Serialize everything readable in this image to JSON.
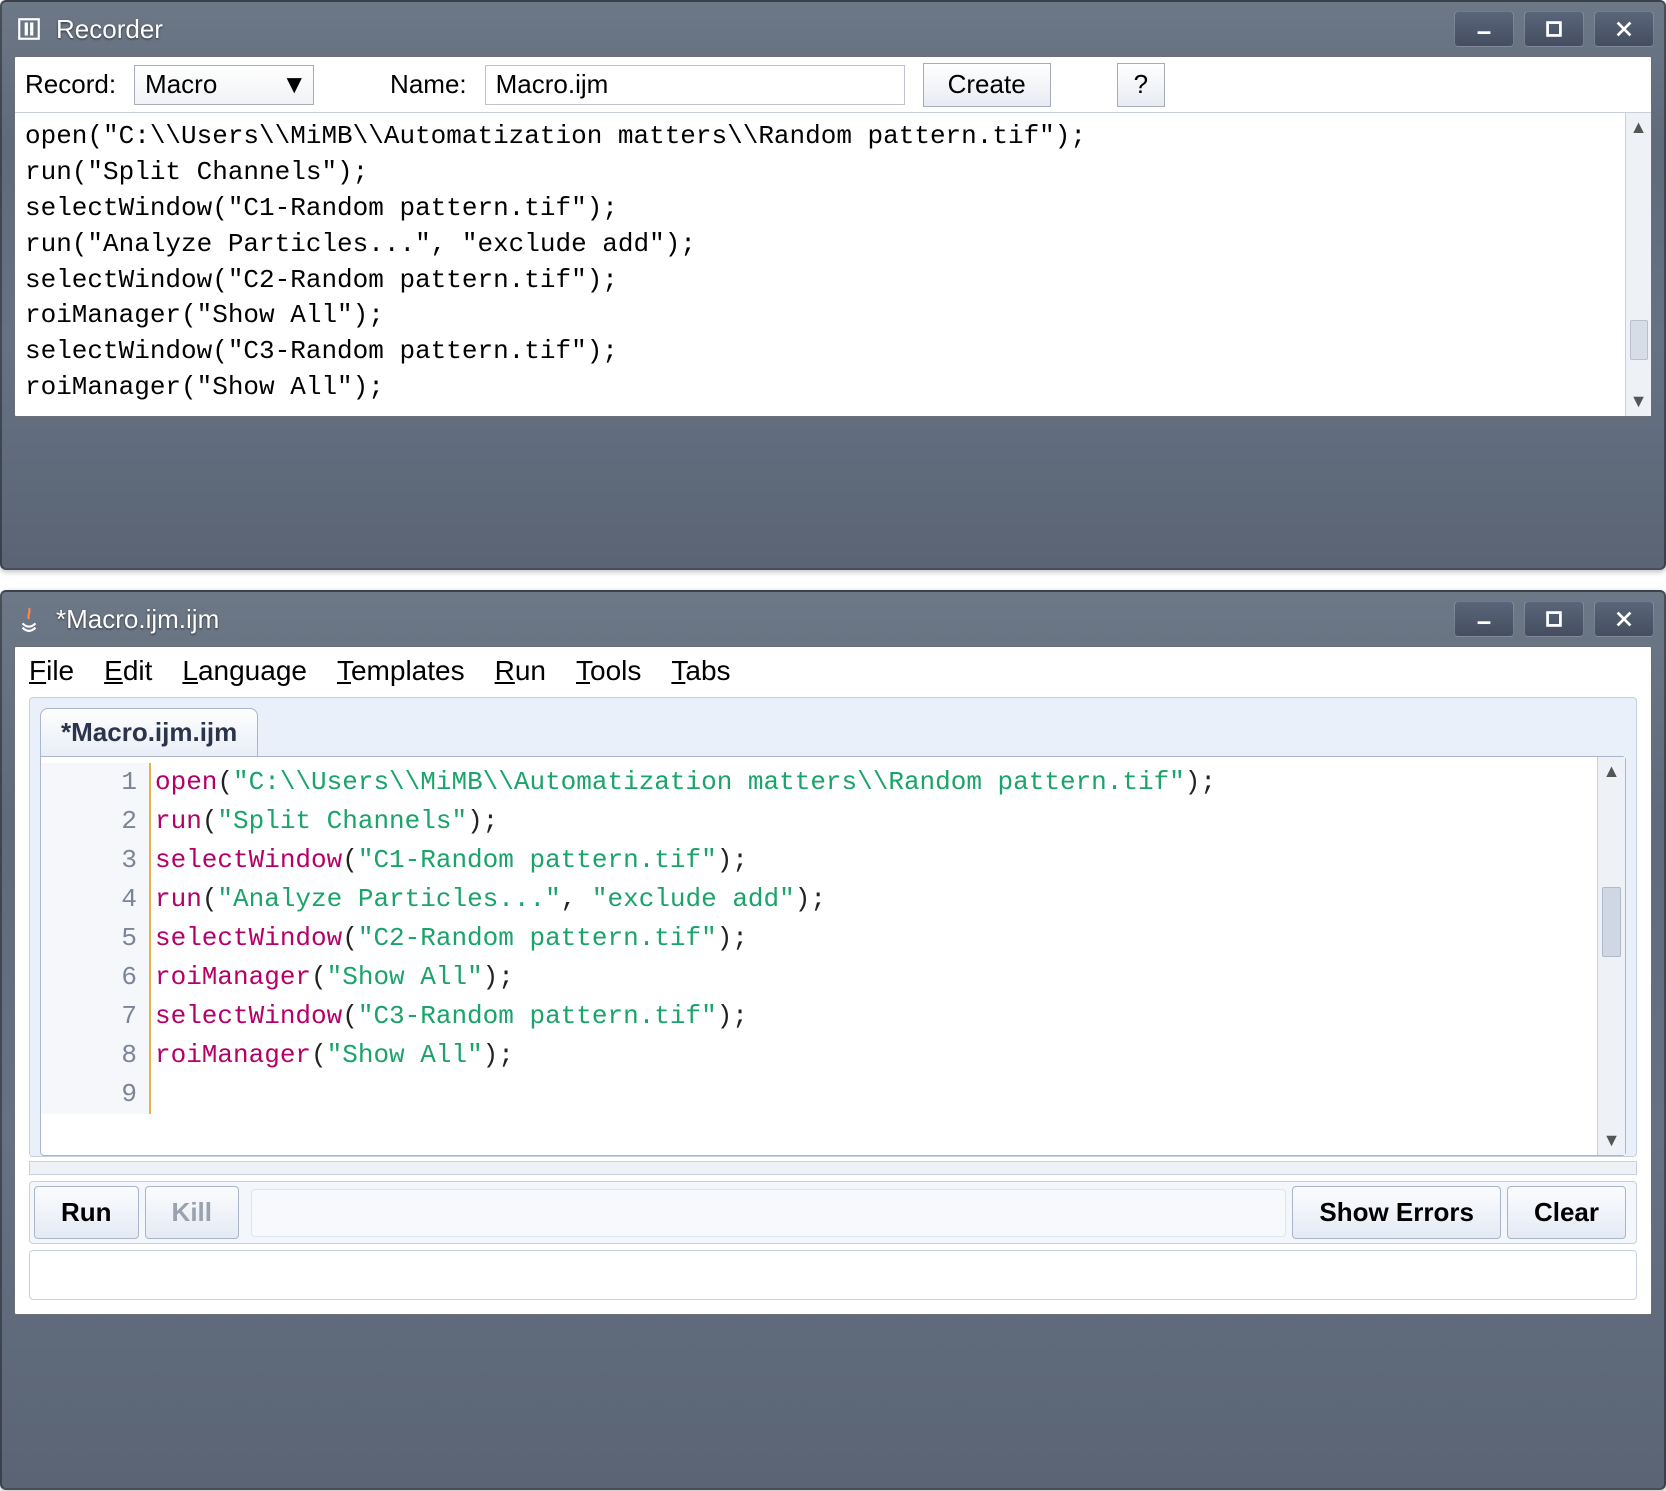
{
  "recorder": {
    "title": "Recorder",
    "record_label": "Record:",
    "record_value": "Macro",
    "name_label": "Name:",
    "name_value": "Macro.ijm",
    "create_label": "Create",
    "help_label": "?",
    "text": "open(\"C:\\\\Users\\\\MiMB\\\\Automatization matters\\\\Random pattern.tif\");\nrun(\"Split Channels\");\nselectWindow(\"C1-Random pattern.tif\");\nrun(\"Analyze Particles...\", \"exclude add\");\nselectWindow(\"C2-Random pattern.tif\");\nroiManager(\"Show All\");\nselectWindow(\"C3-Random pattern.tif\");\nroiManager(\"Show All\");"
  },
  "editor": {
    "title": "*Macro.ijm.ijm",
    "menus": [
      "File",
      "Edit",
      "Language",
      "Templates",
      "Run",
      "Tools",
      "Tabs"
    ],
    "tab_label": "*Macro.ijm.ijm",
    "lines": [
      {
        "n": 1,
        "tokens": [
          [
            "func",
            "open"
          ],
          [
            "punct",
            "("
          ],
          [
            "str",
            "\"C:\\\\Users\\\\MiMB\\\\Automatization matters\\\\Random pattern.tif\""
          ],
          [
            "punct",
            ");"
          ]
        ]
      },
      {
        "n": 2,
        "tokens": [
          [
            "func",
            "run"
          ],
          [
            "punct",
            "("
          ],
          [
            "str",
            "\"Split Channels\""
          ],
          [
            "punct",
            ");"
          ]
        ]
      },
      {
        "n": 3,
        "tokens": [
          [
            "func",
            "selectWindow"
          ],
          [
            "punct",
            "("
          ],
          [
            "str",
            "\"C1-Random pattern.tif\""
          ],
          [
            "punct",
            ");"
          ]
        ]
      },
      {
        "n": 4,
        "tokens": [
          [
            "func",
            "run"
          ],
          [
            "punct",
            "("
          ],
          [
            "str",
            "\"Analyze Particles...\""
          ],
          [
            "punct",
            ", "
          ],
          [
            "str",
            "\"exclude add\""
          ],
          [
            "punct",
            ");"
          ]
        ]
      },
      {
        "n": 5,
        "tokens": [
          [
            "func",
            "selectWindow"
          ],
          [
            "punct",
            "("
          ],
          [
            "str",
            "\"C2-Random pattern.tif\""
          ],
          [
            "punct",
            ");"
          ]
        ]
      },
      {
        "n": 6,
        "tokens": [
          [
            "func",
            "roiManager"
          ],
          [
            "punct",
            "("
          ],
          [
            "str",
            "\"Show All\""
          ],
          [
            "punct",
            ");"
          ]
        ]
      },
      {
        "n": 7,
        "tokens": [
          [
            "func",
            "selectWindow"
          ],
          [
            "punct",
            "("
          ],
          [
            "str",
            "\"C3-Random pattern.tif\""
          ],
          [
            "punct",
            ");"
          ]
        ]
      },
      {
        "n": 8,
        "tokens": [
          [
            "func",
            "roiManager"
          ],
          [
            "punct",
            "("
          ],
          [
            "str",
            "\"Show All\""
          ],
          [
            "punct",
            ");"
          ]
        ]
      },
      {
        "n": 9,
        "tokens": []
      }
    ],
    "run_label": "Run",
    "kill_label": "Kill",
    "show_errors_label": "Show Errors",
    "clear_label": "Clear"
  }
}
